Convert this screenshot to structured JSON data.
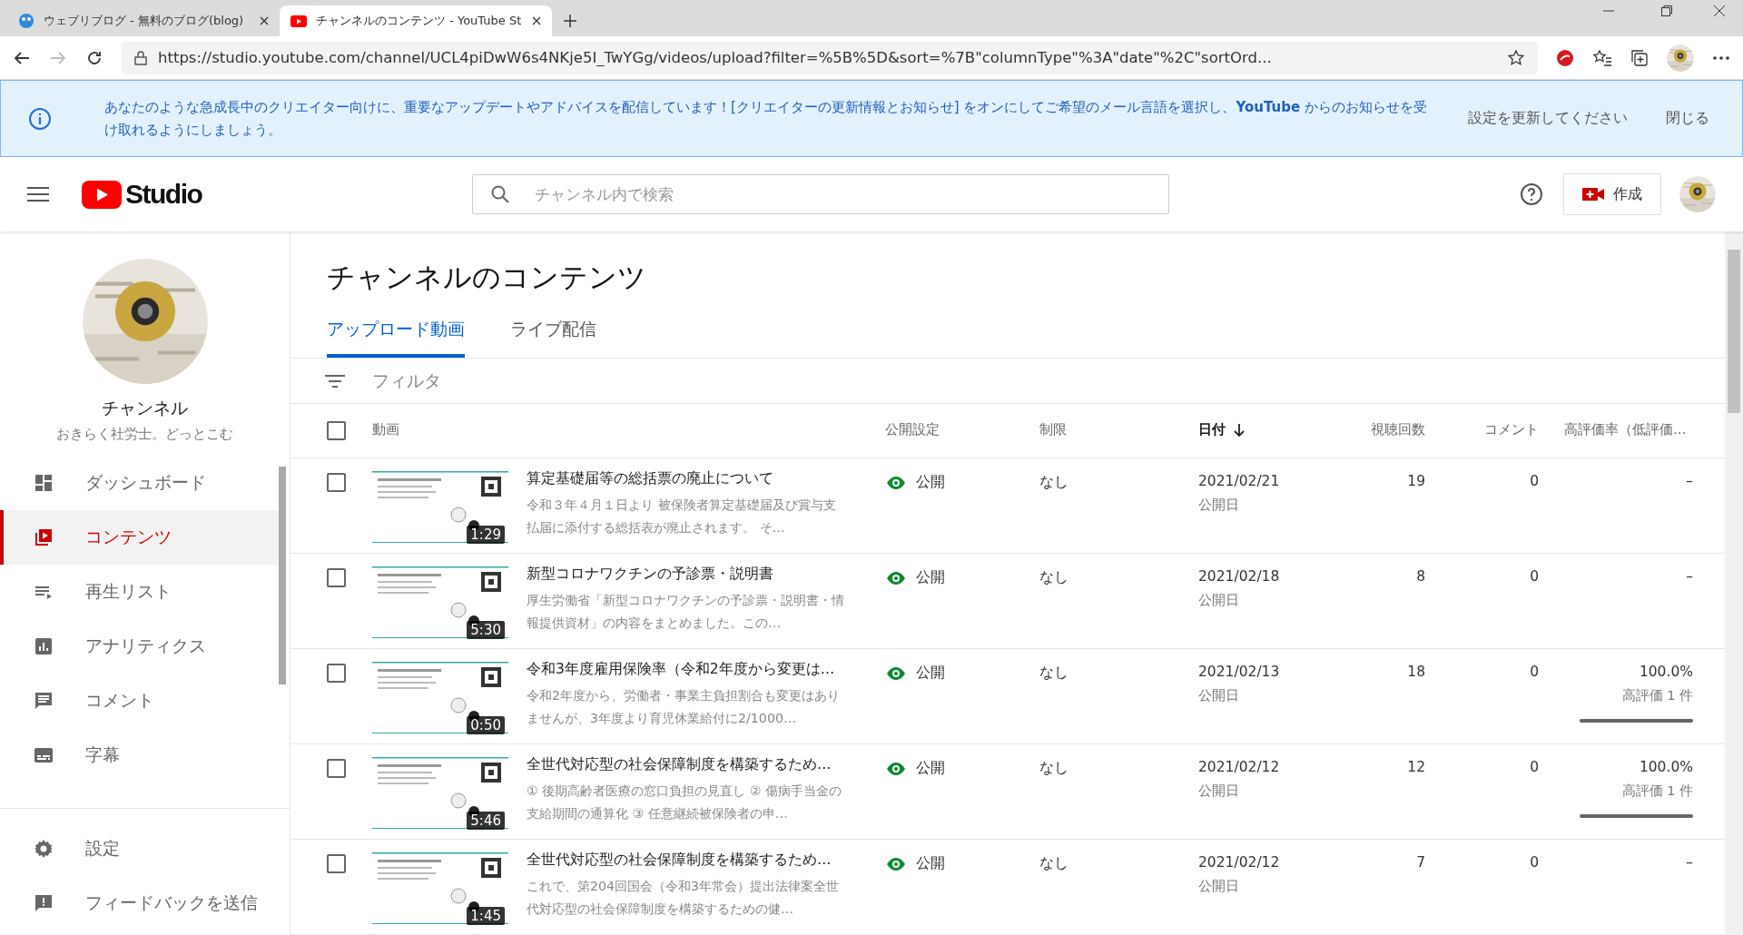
{
  "browser": {
    "tabs": [
      {
        "kind": "blog",
        "title": "ウェブリブログ - 無料のブログ(blog)",
        "selected": false
      },
      {
        "kind": "youtube",
        "title": "チャンネルのコンテンツ - YouTube St",
        "selected": true
      }
    ],
    "url": "https://studio.youtube.com/channel/UCL4piDwW6s4NKje5I_TwYGg/videos/upload?filter=%5B%5D&sort=%7B\"columnType\"%3A\"date\"%2C\"sortOrd..."
  },
  "banner": {
    "text": "あなたのような急成長中のクリエイター向けに、重要なアップデートやアドバイスを配信しています！[クリエイターの更新情報とお知らせ] をオンにしてご希望のメール言語を選択し、**YouTube** からのお知らせを受け取れるようにしましょう。",
    "action": "設定を更新してください",
    "close": "閉じる"
  },
  "header": {
    "logo": "Studio",
    "search_placeholder": "チャンネル内で検索",
    "create": "作成"
  },
  "sidebar": {
    "channel_title": "チャンネル",
    "channel_name": "おきらく社労士。どっとこむ",
    "items": [
      {
        "kind": "dashboard",
        "label": "ダッシュボード",
        "selected": false
      },
      {
        "kind": "content",
        "label": "コンテンツ",
        "selected": true
      },
      {
        "kind": "playlist",
        "label": "再生リスト",
        "selected": false
      },
      {
        "kind": "analytics",
        "label": "アナリティクス",
        "selected": false
      },
      {
        "kind": "comments",
        "label": "コメント",
        "selected": false
      },
      {
        "kind": "subtitles",
        "label": "字幕",
        "selected": false
      }
    ],
    "bottom_items": [
      {
        "kind": "settings",
        "label": "設定"
      },
      {
        "kind": "feedback",
        "label": "フィードバックを送信"
      }
    ]
  },
  "page": {
    "title": "チャンネルのコンテンツ",
    "tabs": [
      {
        "label": "アップロード動画",
        "selected": true
      },
      {
        "label": "ライブ配信",
        "selected": false
      }
    ],
    "filter": "フィルタ",
    "select_all_checked": false,
    "columns": [
      {
        "label": "動画",
        "sorted": false
      },
      {
        "label": "公開設定",
        "sorted": false
      },
      {
        "label": "制限",
        "sorted": false
      },
      {
        "label": "日付",
        "sorted": true
      },
      {
        "label": "視聴回数",
        "sorted": false
      },
      {
        "label": "コメント",
        "sorted": false
      },
      {
        "label": "高評価率（低評価…",
        "sorted": false
      }
    ],
    "rows": [
      {
        "checked": false,
        "duration": "1:29",
        "title": "算定基礎届等の総括票の廃止について",
        "description": "令和３年４月１日より 被保険者算定基礎届及び賞与支払届に添付する総括表が廃止されます。 そ…",
        "visibility": "公開",
        "restriction": "なし",
        "date": "2021/02/21",
        "date_label": "公開日",
        "views": "19",
        "comments": "0",
        "rating": "–"
      },
      {
        "checked": false,
        "duration": "5:30",
        "title": "新型コロナワクチンの予診票・説明書",
        "description": "厚生労働省「新型コロナワクチンの予診票・説明書・情報提供資材」の内容をまとめました。この…",
        "visibility": "公開",
        "restriction": "なし",
        "date": "2021/02/18",
        "date_label": "公開日",
        "views": "8",
        "comments": "0",
        "rating": "–"
      },
      {
        "checked": false,
        "duration": "0:50",
        "title": "令和3年度雇用保険率（令和2年度から変更は…",
        "description": "令和2年度から、労働者・事業主負担割合も変更はありませんが、3年度より育児休業給付に2/1000…",
        "visibility": "公開",
        "restriction": "なし",
        "date": "2021/02/13",
        "date_label": "公開日",
        "views": "18",
        "comments": "0",
        "rating": "100.0%",
        "rating_detail": "高評価 1 件",
        "level": 1
      },
      {
        "checked": false,
        "duration": "5:46",
        "title": "全世代対応型の社会保障制度を構築するため…",
        "description": "① 後期高齢者医療の窓口負担の見直し ② 傷病手当金の支給期間の通算化 ③ 任意継続被保険者の申…",
        "visibility": "公開",
        "restriction": "なし",
        "date": "2021/02/12",
        "date_label": "公開日",
        "views": "12",
        "comments": "0",
        "rating": "100.0%",
        "rating_detail": "高評価 1 件",
        "level": 1
      },
      {
        "checked": false,
        "duration": "1:45",
        "title": "全世代対応型の社会保障制度を構築するため…",
        "description": "これで、第204回国会（令和3年常会）提出法律案全世代対応型の社会保障制度を構築するための健…",
        "visibility": "公開",
        "restriction": "なし",
        "date": "2021/02/12",
        "date_label": "公開日",
        "views": "7",
        "comments": "0",
        "rating": "–"
      }
    ]
  }
}
